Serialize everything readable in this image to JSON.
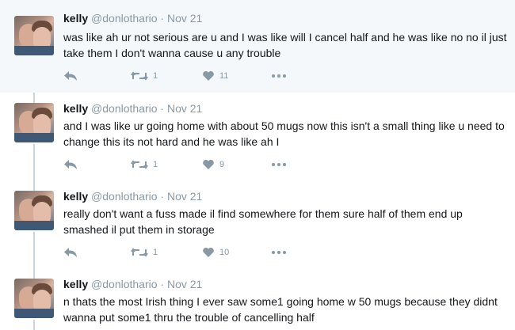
{
  "tweets": [
    {
      "name": "kelly",
      "handle": "@donlothario",
      "time": "Nov 21",
      "text": "was like ah ur not serious are u and I was like will I cancel half and he was like no no il just take them I don't wanna cause u any trouble",
      "retweets": "1",
      "likes": "11"
    },
    {
      "name": "kelly",
      "handle": "@donlothario",
      "time": "Nov 21",
      "text": "and I was like ur going home with about 50 mugs now this isn't a small thing like u need to change this its not hard and he was like ah I",
      "retweets": "1",
      "likes": "9"
    },
    {
      "name": "kelly",
      "handle": "@donlothario",
      "time": "Nov 21",
      "text": "really don't want a fuss made il find somewhere for them sure half of them end up smashed il put them in storage",
      "retweets": "1",
      "likes": "10"
    },
    {
      "name": "kelly",
      "handle": "@donlothario",
      "time": "Nov 21",
      "text": "n thats the most Irish thing I ever saw some1 going home w 50 mugs because they didnt wanna put some1 thru the trouble of cancelling half",
      "retweets": "",
      "likes": ""
    }
  ],
  "icons": {
    "reply": "reply-arrow-icon",
    "retweet": "retweet-icon",
    "like": "heart-icon",
    "more": "more-dots-icon"
  },
  "colors": {
    "highlight_bg": "#f5f8fa",
    "muted": "#8899a6",
    "thread_line": "#ccd6dd",
    "text": "#14171a"
  }
}
